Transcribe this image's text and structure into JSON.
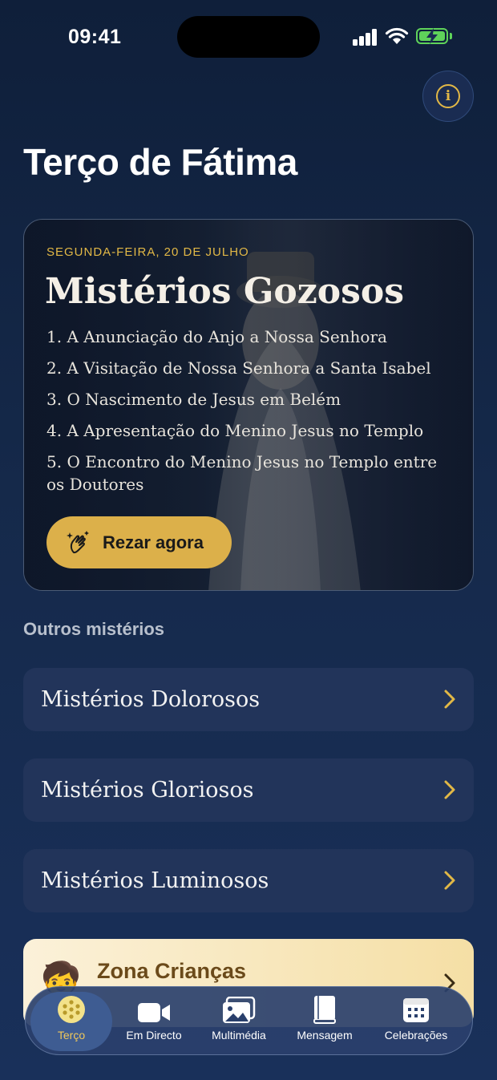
{
  "status_bar": {
    "time": "09:41"
  },
  "header": {
    "title": "Terço de Fátima",
    "info_icon": "info-icon"
  },
  "hero": {
    "date": "SEGUNDA-FEIRA, 20 DE JULHO",
    "title": "Mistérios Gozosos",
    "mysteries": [
      "1. A Anunciação do Anjo a Nossa Senhora",
      "2. A Visitação de Nossa Senhora a Santa Isabel",
      "3. O Nascimento de Jesus em Belém",
      "4. A Apresentação do Menino Jesus no Templo",
      "5. O Encontro do Menino Jesus no Templo entre os Doutores"
    ],
    "button_label": "Rezar agora",
    "button_icon": "praying-hands-icon"
  },
  "other": {
    "label": "Outros mistérios",
    "items": [
      "Mistérios Dolorosos",
      "Mistérios Gloriosos",
      "Mistérios Luminosos"
    ]
  },
  "kids": {
    "title": "Zona Crianças",
    "emoji": "🧒"
  },
  "tabs": [
    {
      "label": "Terço",
      "icon": "rosary-icon",
      "active": true
    },
    {
      "label": "Em Directo",
      "icon": "video-camera-icon",
      "active": false
    },
    {
      "label": "Multimédia",
      "icon": "photo-gallery-icon",
      "active": false
    },
    {
      "label": "Mensagem",
      "icon": "book-icon",
      "active": false
    },
    {
      "label": "Celebrações",
      "icon": "calendar-icon",
      "active": false
    }
  ],
  "colors": {
    "accent": "#dcb04a",
    "background": "#15294a",
    "row": "#22345a"
  }
}
